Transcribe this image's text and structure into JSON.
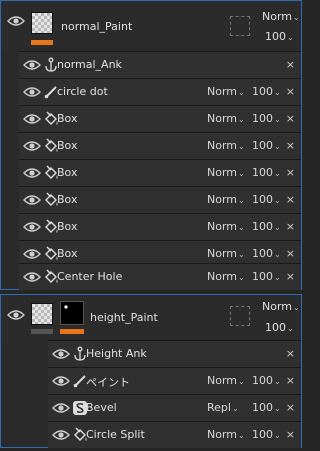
{
  "groups": [
    {
      "name": "normal_Paint",
      "blend": "Norm",
      "opacity": "100",
      "thumb_bar_color": "#e8751a",
      "children": [
        {
          "name": "normal_Ank",
          "icon": "anchor-icon",
          "blend": "",
          "opacity": ""
        },
        {
          "name": "circle dot",
          "icon": "brush-icon",
          "blend": "Norm",
          "opacity": "100"
        },
        {
          "name": "Box",
          "icon": "fill-bucket-icon",
          "blend": "Norm",
          "opacity": "100"
        },
        {
          "name": "Box",
          "icon": "fill-bucket-icon",
          "blend": "Norm",
          "opacity": "100"
        },
        {
          "name": "Box",
          "icon": "fill-bucket-icon",
          "blend": "Norm",
          "opacity": "100"
        },
        {
          "name": "Box",
          "icon": "fill-bucket-icon",
          "blend": "Norm",
          "opacity": "100"
        },
        {
          "name": "Box",
          "icon": "fill-bucket-icon",
          "blend": "Norm",
          "opacity": "100"
        },
        {
          "name": "Box",
          "icon": "fill-bucket-icon",
          "blend": "Norm",
          "opacity": "100"
        },
        {
          "name": "Center Hole",
          "icon": "fill-bucket-icon",
          "blend": "Norm",
          "opacity": "100"
        }
      ]
    },
    {
      "name": "height_Paint",
      "blend": "Norm",
      "opacity": "100",
      "thumb_bar_color": "#e8751a",
      "children": [
        {
          "name": "Height Ank",
          "icon": "anchor-icon",
          "blend": "",
          "opacity": ""
        },
        {
          "name": "ペイント",
          "icon": "brush-icon",
          "blend": "Norm",
          "opacity": "100"
        },
        {
          "name": "Bevel",
          "icon": "filter-s-icon",
          "blend": "Repl",
          "opacity": "100"
        },
        {
          "name": "Circle Split",
          "icon": "fill-bucket-icon",
          "blend": "Norm",
          "opacity": "100"
        }
      ]
    }
  ],
  "chevron": "⌄",
  "close_glyph": "×",
  "colors": {
    "selection_border": "#2f6db0",
    "accent": "#e8751a"
  }
}
